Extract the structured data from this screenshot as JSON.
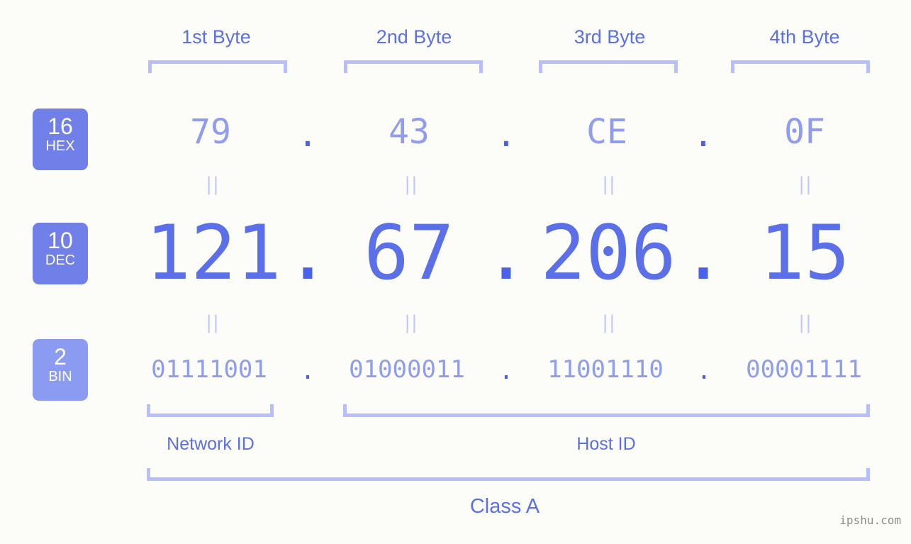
{
  "watermark": "ipshu.com",
  "byte_headers": [
    {
      "label": "1st Byte"
    },
    {
      "label": "2nd Byte"
    },
    {
      "label": "3rd Byte"
    },
    {
      "label": "4th Byte"
    }
  ],
  "bases": [
    {
      "number": "16",
      "name": "HEX",
      "color": "#7180e8"
    },
    {
      "number": "10",
      "name": "DEC",
      "color": "#7180e8"
    },
    {
      "number": "2",
      "name": "BIN",
      "color": "#8c9bf2"
    }
  ],
  "rows": {
    "hex": {
      "base_number": "16",
      "base_name": "HEX",
      "octets": [
        "79",
        "43",
        "CE",
        "0F"
      ],
      "separator": "."
    },
    "dec": {
      "base_number": "10",
      "base_name": "DEC",
      "octets": [
        "121",
        "67",
        "206",
        "15"
      ],
      "separator": "."
    },
    "bin": {
      "base_number": "2",
      "base_name": "BIN",
      "octets": [
        "01111001",
        "01000011",
        "11001110",
        "00001111"
      ],
      "separator": "."
    }
  },
  "equals_symbol": "||",
  "sections": {
    "network_id": "Network ID",
    "host_id": "Host ID",
    "class": "Class A"
  },
  "colors": {
    "background": "#fcfdf8",
    "accent_strong": "#5b6fe8",
    "accent_light": "#8f9cf0",
    "bracket": "#b6bffb",
    "badge_dark": "#7180e8",
    "badge_light": "#8c9bf2",
    "dot": "#4a62e8",
    "watermark": "#8c8c8c"
  },
  "ip_address": {
    "decimal": "121.67.206.15",
    "hex": "79.43.CE.0F",
    "binary": "01111001.01000011.11001110.00001111",
    "class": "Class A"
  }
}
